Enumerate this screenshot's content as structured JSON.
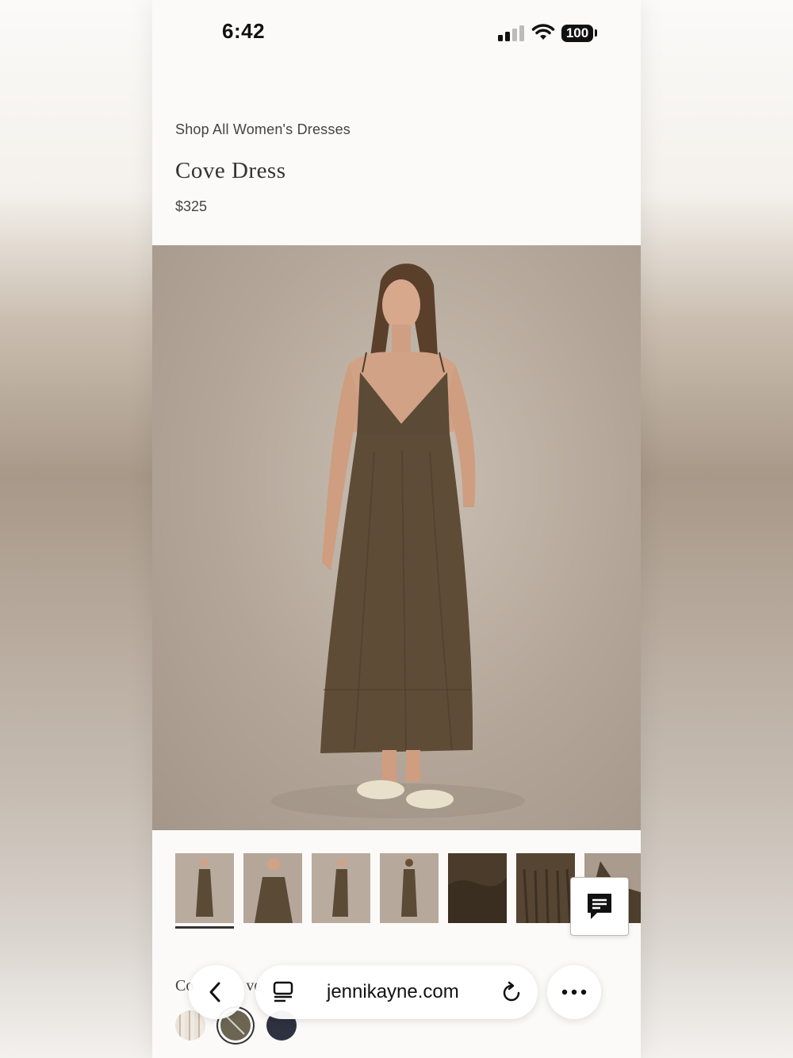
{
  "status_bar": {
    "time": "6:42",
    "battery": "100"
  },
  "breadcrumb": "Shop All Women's Dresses",
  "product": {
    "title": "Cove Dress",
    "price": "$325"
  },
  "thumbnails": [
    {
      "label": "model-front"
    },
    {
      "label": "model-closeup"
    },
    {
      "label": "model-side"
    },
    {
      "label": "model-back"
    },
    {
      "label": "fabric-detail"
    },
    {
      "label": "gather-detail"
    },
    {
      "label": "strap-detail"
    }
  ],
  "color_label_visible": "Co",
  "color_label_visible_2": "ve",
  "swatches": [
    {
      "name": "stripe",
      "color": "#e9e3da"
    },
    {
      "name": "olive",
      "color": "#6c6552",
      "selected": true
    },
    {
      "name": "navy",
      "color": "#2d3140"
    }
  ],
  "browser": {
    "url": "jennikayne.com"
  },
  "colors": {
    "dress": "#5b4a36",
    "background": "#b3a699",
    "text": "#333333"
  }
}
